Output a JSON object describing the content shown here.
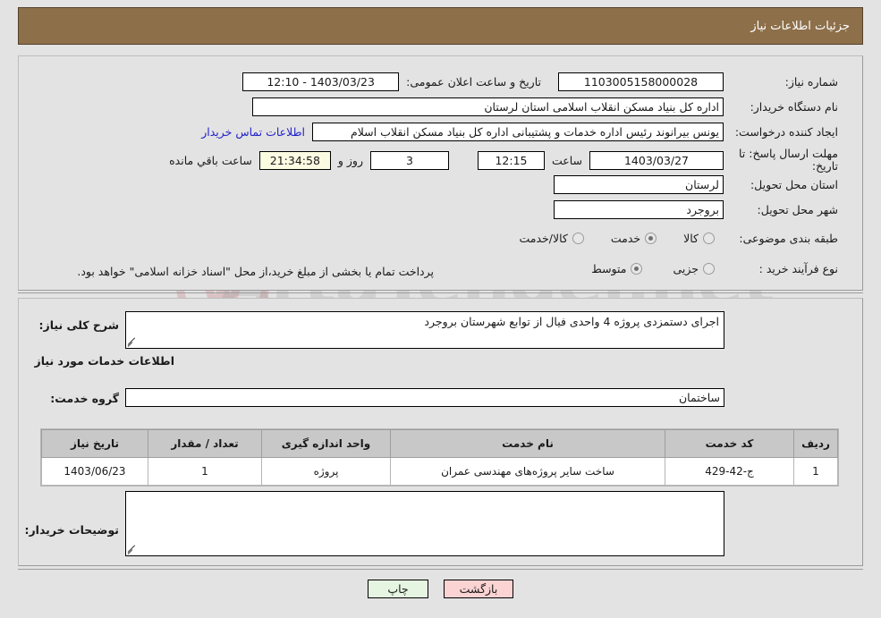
{
  "header": {
    "title": "جزئیات اطلاعات نیاز"
  },
  "watermark": {
    "text": "ArtaTender.net"
  },
  "top_panel": {
    "need_number_label": "شماره نیاز:",
    "need_number_value": "1103005158000028",
    "announce_label": "تاریخ و ساعت اعلان عمومی:",
    "announce_value": "1403/03/23 - 12:10",
    "buyer_org_label": "نام دستگاه خریدار:",
    "buyer_org_value": "اداره کل بنیاد مسکن انقلاب اسلامی استان لرستان",
    "creator_label": "ایجاد کننده درخواست:",
    "creator_value": "یونس بیرانوند رئیس اداره خدمات و پشتیبانی اداره کل بنیاد مسکن انقلاب اسلام",
    "contact_link": "اطلاعات تماس خریدار",
    "deadline_label": "مهلت ارسال پاسخ: تا تاریخ:",
    "deadline_date": "1403/03/27",
    "hour_label": "ساعت",
    "deadline_time": "12:15",
    "remaining_days": "3",
    "days_and_label": "روز و",
    "remaining_time": "21:34:58",
    "remaining_suffix": "ساعت باقي مانده",
    "province_label": "استان محل تحویل:",
    "province_value": "لرستان",
    "city_label": "شهر محل تحویل:",
    "city_value": "بروجرد",
    "category_label": "طبقه بندی موضوعی:",
    "category_options": [
      {
        "label": "کالا",
        "selected": false
      },
      {
        "label": "خدمت",
        "selected": true
      },
      {
        "label": "کالا/خدمت",
        "selected": false
      }
    ],
    "process_label": "نوع فرآیند خرید :",
    "process_options": [
      {
        "label": "جزیی",
        "selected": false
      },
      {
        "label": "متوسط",
        "selected": true
      }
    ],
    "treasury_note": "پرداخت تمام یا بخشی از مبلغ خرید،از محل \"اسناد خزانه اسلامی\" خواهد بود."
  },
  "mid_panel": {
    "description_label": "شرح کلی نیاز:",
    "description_value": "اجرای دستمزدی پروژه 4 واحدی فیال از توابع شهرستان بروجرد",
    "services_section_title": "اطلاعات خدمات مورد نیاز",
    "service_group_label": "گروه خدمت:",
    "service_group_value": "ساختمان",
    "table": {
      "columns": [
        "ردیف",
        "کد خدمت",
        "نام خدمت",
        "واحد اندازه گیری",
        "تعداد / مقدار",
        "تاریخ نیاز"
      ],
      "rows": [
        [
          "1",
          "ج-42-429",
          "ساخت سایر پروژه‌های مهندسی عمران",
          "پروژه",
          "1",
          "1403/06/23"
        ]
      ]
    },
    "buyer_notes_label": "توضیحات خریدار:",
    "buyer_notes_value": ""
  },
  "footer": {
    "print_label": "چاپ",
    "back_label": "بازگشت"
  },
  "colors": {
    "header_bg": "#8d6f4a",
    "page_bg": "#e3e3e3",
    "link": "#2222cc",
    "print_btn": "#e6f5e1",
    "back_btn": "#fbd3d3",
    "highlight_field": "#fbfbe2"
  }
}
